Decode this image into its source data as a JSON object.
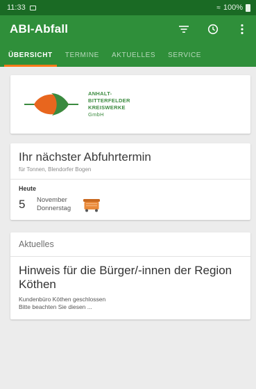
{
  "status_bar": {
    "time": "11:33",
    "battery": "100%"
  },
  "appbar": {
    "title": "ABI-Abfall"
  },
  "tabs": [
    {
      "label": "ÜBERSICHT",
      "active": true
    },
    {
      "label": "TERMINE",
      "active": false
    },
    {
      "label": "AKTUELLES",
      "active": false
    },
    {
      "label": "SERVICE",
      "active": false
    }
  ],
  "logo": {
    "line1": "ANHALT-",
    "line2": "BITTERFELDER",
    "line3": "KREISWERKE",
    "line4": "GmbH"
  },
  "next_pickup": {
    "title": "Ihr nächster Abfuhrtermin",
    "subtitle": "für Tonnen, Blendorfer Bogen",
    "label": "Heute",
    "day": "5",
    "month": "November",
    "weekday": "Donnerstag"
  },
  "news": {
    "header": "Aktuelles",
    "title": "Hinweis für die Bürger/-innen der Region Köthen",
    "line1": "Kundenbüro Köthen geschlossen",
    "line2": "Bitte beachten Sie diesen ..."
  },
  "colors": {
    "statusbar": "#1a6a24",
    "appbar": "#2f8f3a",
    "tab_indicator": "#ff7a1a",
    "logo_orange": "#e8661e",
    "logo_green": "#3b8a3f",
    "bin_orange": "#e98a3a"
  },
  "icons": {
    "filter": "filter-icon",
    "clock": "clock-icon",
    "overflow": "more-vert-icon",
    "bin": "garbage-bin-icon",
    "leaf_logo": "leaf-logo-icon"
  }
}
